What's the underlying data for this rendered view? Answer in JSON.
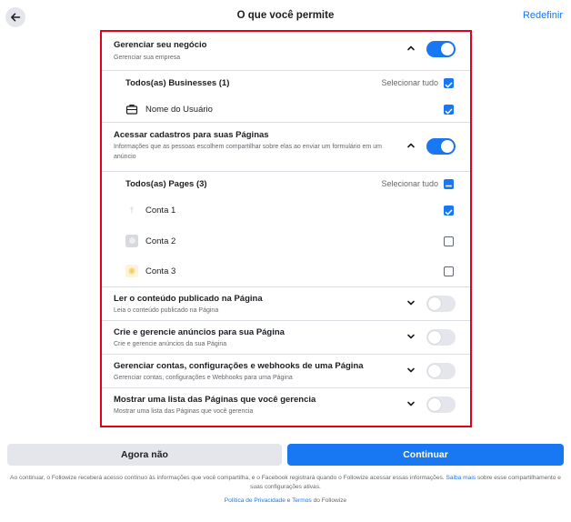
{
  "header": {
    "title": "O que você permite",
    "reset_label": "Redefinir"
  },
  "colors": {
    "accent": "#1877f2",
    "highlight_border": "#e2001a"
  },
  "sections": [
    {
      "title": "Gerenciar seu negócio",
      "subtitle": "Gerenciar sua empresa",
      "expanded": true,
      "enabled": true,
      "group_label": "Todos(as) Businesses (1)",
      "select_all_label": "Selecionar tudo",
      "items": [
        {
          "label": "Nome do Usuário",
          "icon": "briefcase-icon",
          "checked": true
        }
      ]
    },
    {
      "title": "Acessar cadastros para suas Páginas",
      "subtitle": "Informações que as pessoas escolhem compartilhar sobre elas ao enviar um formulário em um anúncio",
      "expanded": true,
      "enabled": true,
      "group_label": "Todos(as) Pages (3)",
      "select_all_label": "Selecionar tudo",
      "items": [
        {
          "label": "Conta 1",
          "icon": "page-avatar-icon",
          "checked": true
        },
        {
          "label": "Conta 2",
          "icon": "page-avatar-icon",
          "checked": false
        },
        {
          "label": "Conta 3",
          "icon": "page-avatar-icon",
          "checked": false
        }
      ]
    },
    {
      "title": "Ler o conteúdo publicado na Página",
      "subtitle": "Leia o conteúdo publicado na Página",
      "expanded": false,
      "enabled": false
    },
    {
      "title": "Crie e gerencie anúncios para sua Página",
      "subtitle": "Crie e gerencie anúncios da sua Página",
      "expanded": false,
      "enabled": false
    },
    {
      "title": "Gerenciar contas, configurações e webhooks de uma Página",
      "subtitle": "Gerenciar contas, configurações e Webhooks para uma Página",
      "expanded": false,
      "enabled": false
    },
    {
      "title": "Mostrar uma lista das Páginas que você gerencia",
      "subtitle": "Mostrar uma lista das Páginas que você gerencia",
      "expanded": false,
      "enabled": false
    }
  ],
  "footer": {
    "cancel_label": "Agora não",
    "continue_label": "Continuar",
    "legal_text_1": "Ao continuar, o Followize receberá acesso contínuo às informações que você compartilha, e o Facebook registrará quando o Followize acessar essas informações.",
    "legal_link": "Saiba mais",
    "legal_text_2": "sobre esse compartilhamento e suas configurações ativas.",
    "privacy_link": "Política de Privacidade",
    "and_text": "e",
    "terms_link": "Termos",
    "of_text": "do Followize"
  }
}
